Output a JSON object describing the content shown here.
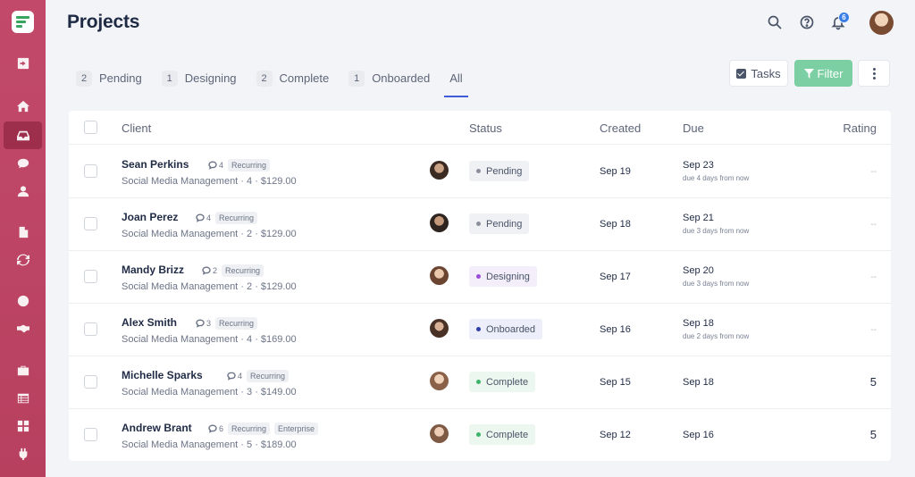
{
  "page": {
    "title": "Projects"
  },
  "header": {
    "notification_count": "6"
  },
  "tabs": [
    {
      "count": "2",
      "label": "Pending"
    },
    {
      "count": "1",
      "label": "Designing"
    },
    {
      "count": "2",
      "label": "Complete"
    },
    {
      "count": "1",
      "label": "Onboarded"
    },
    {
      "count": "",
      "label": "All",
      "active": true
    }
  ],
  "toolbar": {
    "tasks_label": "Tasks",
    "filter_label": "Filter"
  },
  "table": {
    "headers": {
      "client": "Client",
      "status": "Status",
      "created": "Created",
      "due": "Due",
      "rating": "Rating"
    },
    "rows": [
      {
        "name": "Sean Perkins",
        "comments": "4",
        "tags": [
          "Recurring"
        ],
        "subtitle": "Social Media Management · 4 · $129.00",
        "status": "Pending",
        "status_color": "#8a8f9c",
        "status_bg": "#f0f1f4",
        "created": "Sep 19",
        "due": "Sep 23",
        "due_sub": "due 4 days from now",
        "rating": "--"
      },
      {
        "name": "Joan Perez",
        "comments": "4",
        "tags": [
          "Recurring"
        ],
        "subtitle": "Social Media Management · 2 · $129.00",
        "status": "Pending",
        "status_color": "#8a8f9c",
        "status_bg": "#f0f1f4",
        "created": "Sep 18",
        "due": "Sep 21",
        "due_sub": "due 3 days from now",
        "rating": "--"
      },
      {
        "name": "Mandy Brizz",
        "comments": "2",
        "tags": [
          "Recurring"
        ],
        "subtitle": "Social Media Management · 2 · $129.00",
        "status": "Designing",
        "status_color": "#9b4fd9",
        "status_bg": "#f3eefa",
        "created": "Sep 17",
        "due": "Sep 20",
        "due_sub": "due 3 days from now",
        "rating": "--"
      },
      {
        "name": "Alex Smith",
        "comments": "3",
        "tags": [
          "Recurring"
        ],
        "subtitle": "Social Media Management · 4 · $169.00",
        "status": "Onboarded",
        "status_color": "#2f3fa6",
        "status_bg": "#eceefa",
        "created": "Sep 16",
        "due": "Sep 18",
        "due_sub": "due 2 days from now",
        "rating": "--"
      },
      {
        "name": "Michelle Sparks",
        "comments": "4",
        "tags": [
          "Recurring"
        ],
        "subtitle": "Social Media Management · 3 · $149.00",
        "status": "Complete",
        "status_color": "#3cb46a",
        "status_bg": "#ebf7ef",
        "created": "Sep 15",
        "due": "Sep 18",
        "due_sub": "",
        "rating": "5"
      },
      {
        "name": "Andrew Brant",
        "comments": "6",
        "tags": [
          "Recurring",
          "Enterprise"
        ],
        "subtitle": "Social Media Management · 5 · $189.00",
        "status": "Complete",
        "status_color": "#3cb46a",
        "status_bg": "#ebf7ef",
        "created": "Sep 12",
        "due": "Sep 16",
        "due_sub": "",
        "rating": "5"
      }
    ]
  },
  "sidebar": {
    "items": [
      {
        "icon": "arrow-right-square-icon"
      },
      {
        "icon": "home-icon"
      },
      {
        "icon": "inbox-icon",
        "active": true
      },
      {
        "icon": "chat-icon"
      },
      {
        "icon": "user-icon"
      },
      {
        "icon": "document-icon"
      },
      {
        "icon": "refresh-icon"
      },
      {
        "icon": "settings-icon"
      },
      {
        "icon": "handshake-icon"
      },
      {
        "icon": "briefcase-icon"
      },
      {
        "icon": "table-icon"
      },
      {
        "icon": "grid-icon"
      },
      {
        "icon": "plug-icon"
      }
    ]
  }
}
